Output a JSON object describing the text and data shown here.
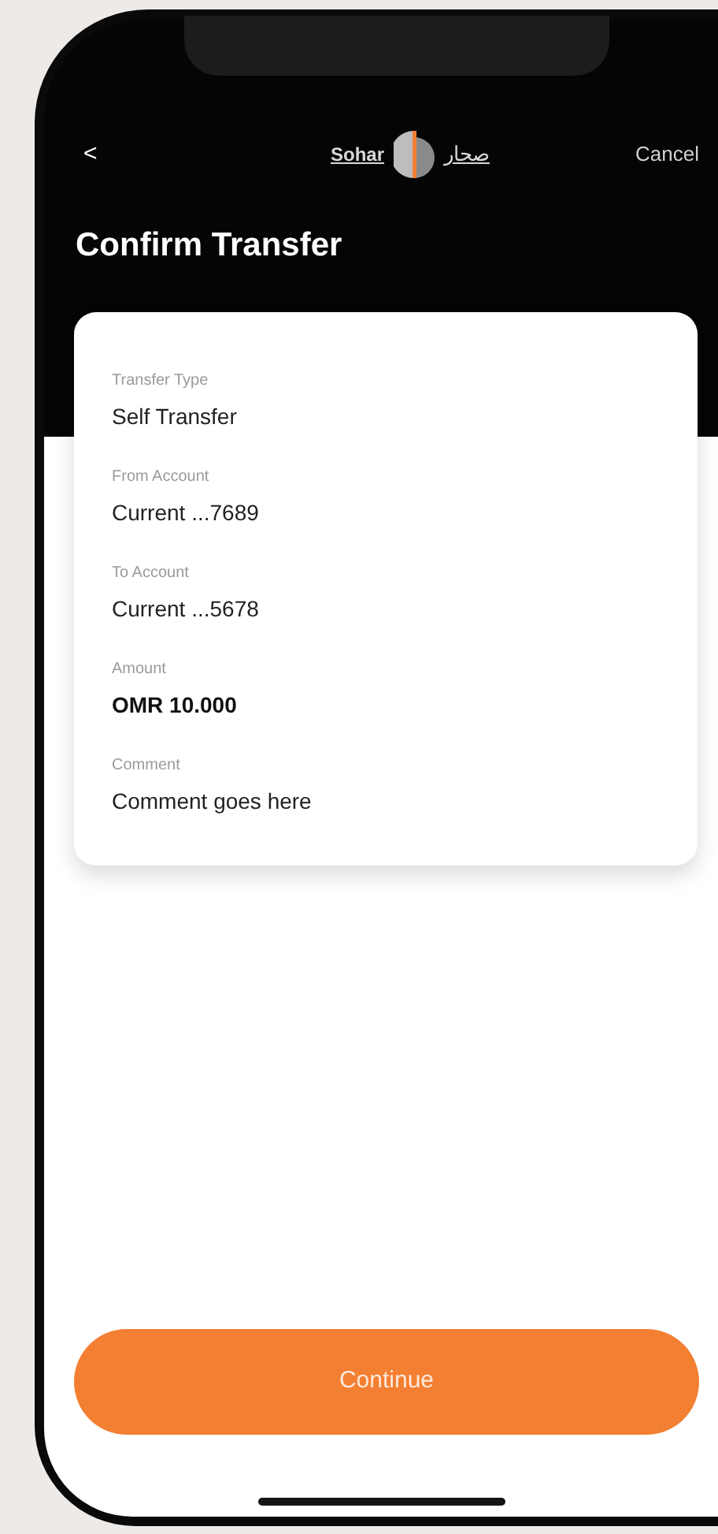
{
  "nav": {
    "back": "<",
    "brand_latin": "Sohar",
    "brand_arabic": "صحار",
    "cancel": "Cancel"
  },
  "title": "Confirm Transfer",
  "details": [
    {
      "kind": "text",
      "label": "Transfer Type",
      "value": "Self Transfer"
    },
    {
      "kind": "text",
      "label": "From Account",
      "value": "Current ...7689"
    },
    {
      "kind": "text",
      "label": "To Account",
      "value": "Current ...5678"
    },
    {
      "kind": "amount",
      "label": "Amount",
      "value": "OMR 10.000"
    },
    {
      "kind": "text",
      "label": "Comment",
      "value": "Comment goes here"
    }
  ],
  "primary_button": "Continue"
}
